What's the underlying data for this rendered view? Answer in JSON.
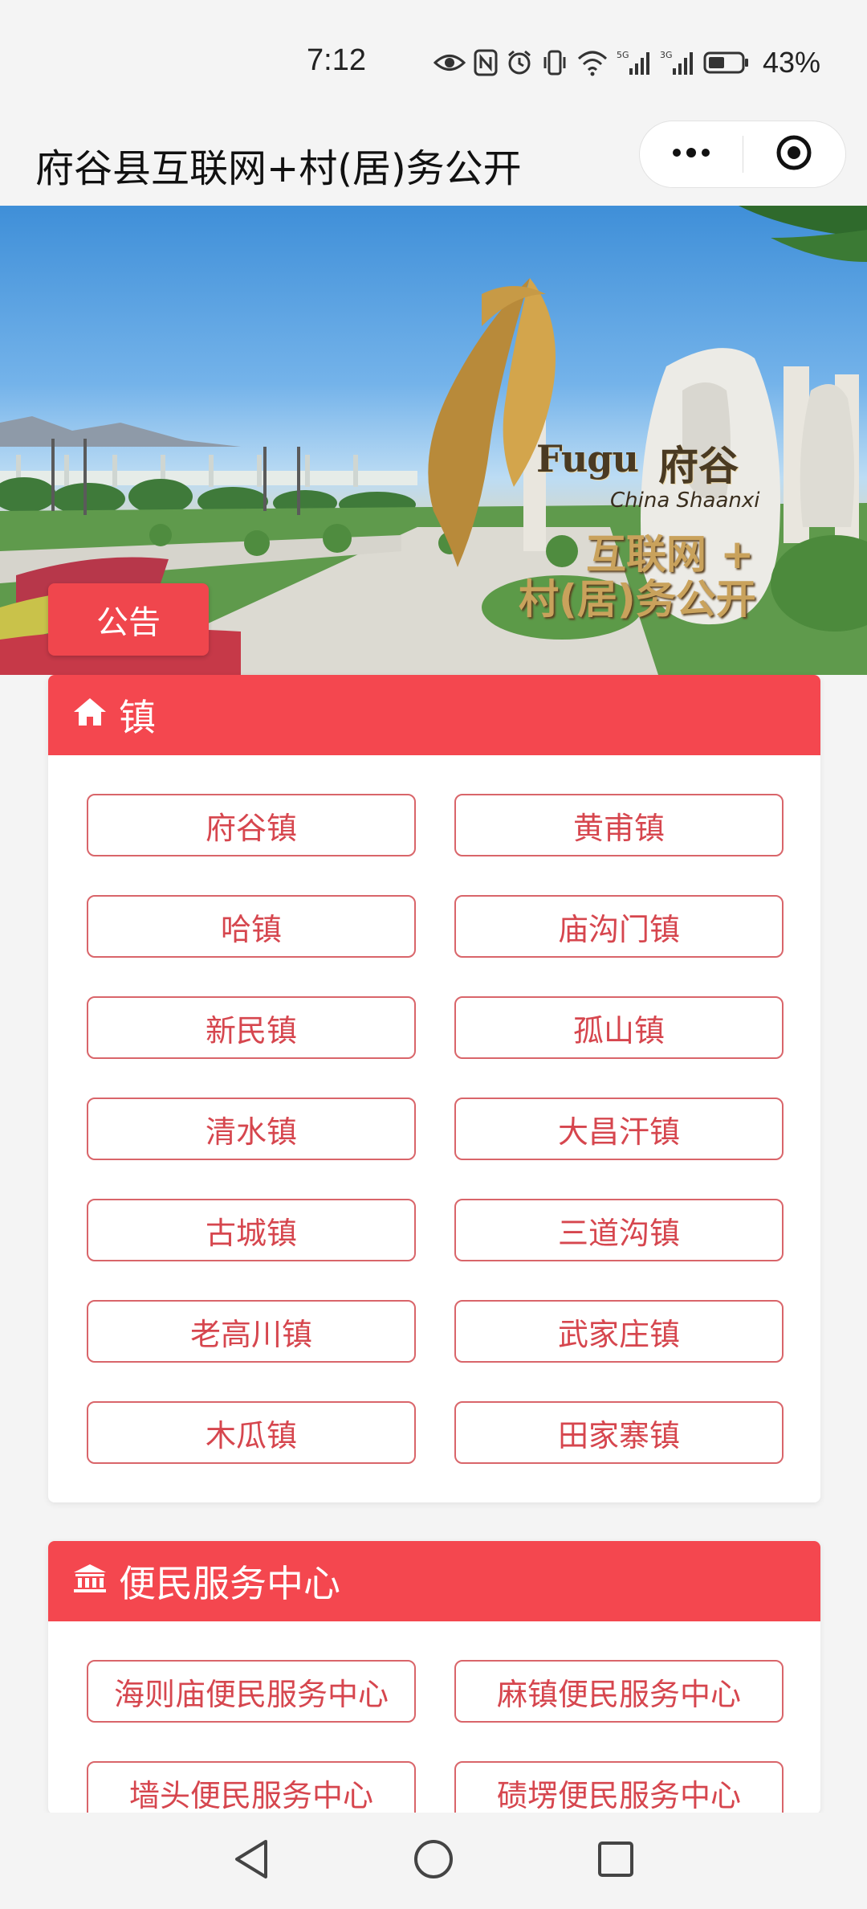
{
  "status_bar": {
    "time": "7:12",
    "battery_pct": "43%",
    "icons": [
      "eye-icon",
      "nfc-icon",
      "alarm-icon",
      "vibrate-icon",
      "wifi-icon",
      "signal-5g-icon",
      "signal-3g-icon",
      "battery-icon"
    ]
  },
  "title_bar": {
    "title": "府谷县互联网+村(居)务公开",
    "more_icon": "more-dots-icon",
    "close_icon": "target-close-icon"
  },
  "banner": {
    "logo_en": "Fugu",
    "logo_cn": "府谷",
    "logo_sub": "China Shaanxi",
    "slogan_line1": "互联网 +",
    "slogan_line2": "村(居)务公开",
    "notice_label": "公告"
  },
  "towns": {
    "header": "镇",
    "icon": "home-icon",
    "items": [
      "府谷镇",
      "黄甫镇",
      "哈镇",
      "庙沟门镇",
      "新民镇",
      "孤山镇",
      "清水镇",
      "大昌汗镇",
      "古城镇",
      "三道沟镇",
      "老高川镇",
      "武家庄镇",
      "木瓜镇",
      "田家寨镇"
    ]
  },
  "centers": {
    "header": "便民服务中心",
    "icon": "building-icon",
    "items": [
      "海则庙便民服务中心",
      "麻镇便民服务中心",
      "墙头便民服务中心",
      "碛塄便民服务中心"
    ]
  },
  "nav": {
    "back_icon": "back-triangle-icon",
    "home_icon": "home-circle-icon",
    "recents_icon": "recents-square-icon"
  },
  "colors": {
    "accent": "#f4474f",
    "button_text": "#d6464e",
    "button_border": "#d9656a"
  }
}
